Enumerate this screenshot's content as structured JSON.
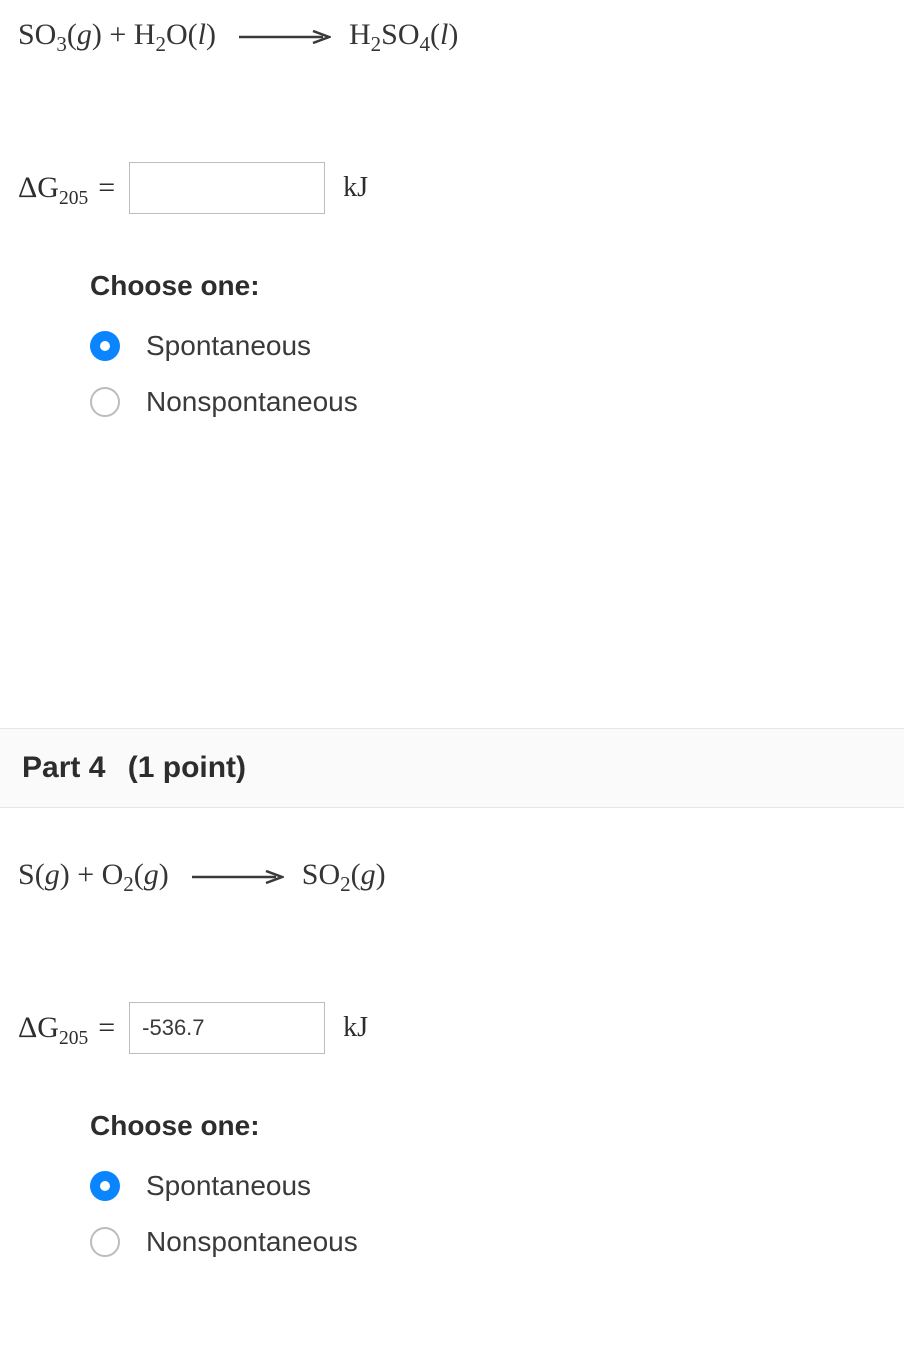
{
  "part3": {
    "equation": {
      "reactant_a": "SO",
      "reactant_a_sub": "3",
      "reactant_a_phase": "g",
      "plus": "+",
      "reactant_b": "H",
      "reactant_b_sub": "2",
      "reactant_b2": "O",
      "reactant_b_phase": "l",
      "product": "H",
      "product_sub1": "2",
      "product_2": "SO",
      "product_sub2": "4",
      "product_phase": "l"
    },
    "dg": {
      "delta": "Δ",
      "g": "G",
      "sub": "205",
      "equals": "=",
      "value": "",
      "unit": "kJ"
    },
    "choose_title": "Choose one:",
    "options": [
      {
        "label": "Spontaneous",
        "checked": true
      },
      {
        "label": "Nonspontaneous",
        "checked": false
      }
    ]
  },
  "part4": {
    "header_label": "Part 4",
    "points_label": "(1 point)",
    "equation": {
      "reactant_a": "S",
      "reactant_a_phase": "g",
      "plus": "+",
      "reactant_b": "O",
      "reactant_b_sub": "2",
      "reactant_b_phase": "g",
      "product": "SO",
      "product_sub": "2",
      "product_phase": "g"
    },
    "dg": {
      "delta": "Δ",
      "g": "G",
      "sub": "205",
      "equals": "=",
      "value": "-536.7",
      "unit": "kJ"
    },
    "choose_title": "Choose one:",
    "options": [
      {
        "label": "Spontaneous",
        "checked": true
      },
      {
        "label": "Nonspontaneous",
        "checked": false
      }
    ]
  }
}
